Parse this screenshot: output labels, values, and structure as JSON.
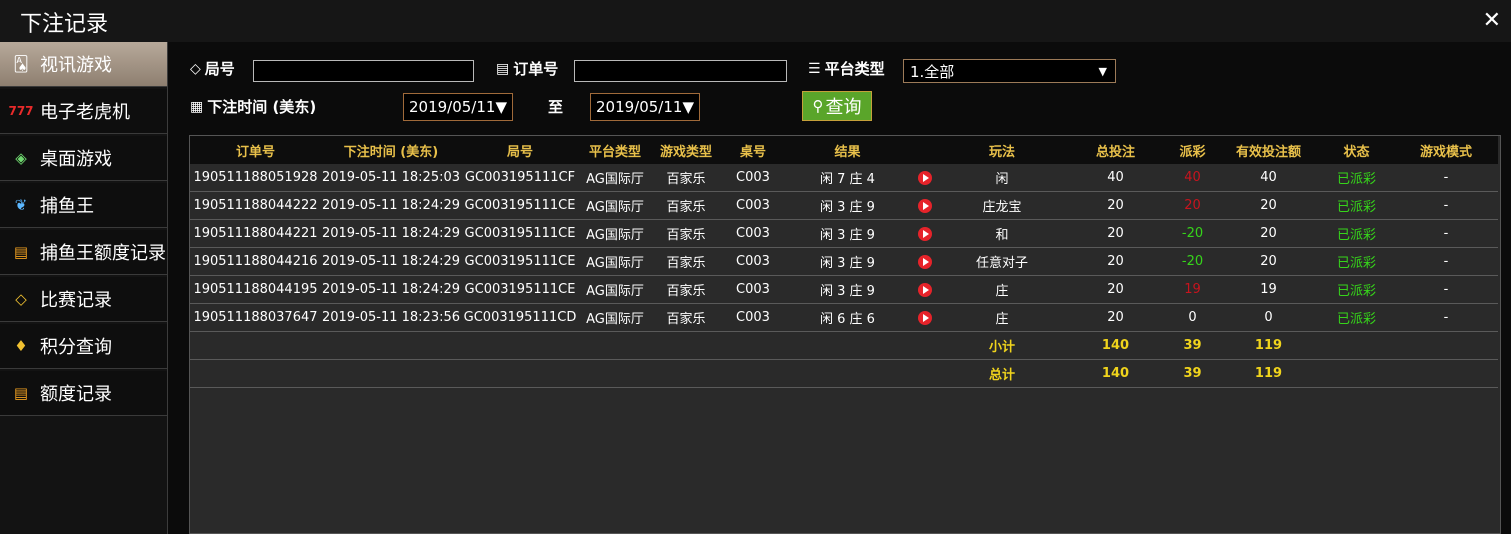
{
  "window": {
    "title": "下注记录",
    "close_icon": "close-icon"
  },
  "sidebar": {
    "items": [
      {
        "label": "视讯游戏",
        "icon": "cards-icon",
        "active": true
      },
      {
        "label": "电子老虎机",
        "icon": "slot-777-icon",
        "active": false
      },
      {
        "label": "桌面游戏",
        "icon": "chips-icon",
        "active": false
      },
      {
        "label": "捕鱼王",
        "icon": "fish-icon",
        "active": false
      },
      {
        "label": "捕鱼王额度记录",
        "icon": "doc-icon",
        "active": false
      },
      {
        "label": "比赛记录",
        "icon": "ticket-icon",
        "active": false
      },
      {
        "label": "积分查询",
        "icon": "diamond-icon",
        "active": false
      },
      {
        "label": "额度记录",
        "icon": "doc-icon",
        "active": false
      }
    ]
  },
  "filters": {
    "round_label": "局号",
    "round_value": "",
    "order_label": "订单号",
    "order_value": "",
    "platform_label": "平台类型",
    "platform_selected": "1.全部",
    "time_label": "下注时间 (美东)",
    "date_from": "2019/05/11",
    "to_label": "至",
    "date_to": "2019/05/11",
    "query_label": "查询"
  },
  "table": {
    "headers": [
      "订单号",
      "下注时间 (美东)",
      "局号",
      "平台类型",
      "游戏类型",
      "桌号",
      "结果",
      "",
      "玩法",
      "总投注",
      "派彩",
      "有效投注额",
      "状态",
      "游戏模式"
    ],
    "rows": [
      {
        "order": "190511188051928",
        "time": "2019-05-11 18:25:03",
        "round": "GC003195111CF",
        "platform": "AG国际厅",
        "game": "百家乐",
        "table": "C003",
        "result": "闲 7 庄 4",
        "play": "闲",
        "bet": "40",
        "payout": "40",
        "payout_color": "red",
        "valid": "40",
        "status": "已派彩",
        "mode": "-"
      },
      {
        "order": "190511188044222",
        "time": "2019-05-11 18:24:29",
        "round": "GC003195111CE",
        "platform": "AG国际厅",
        "game": "百家乐",
        "table": "C003",
        "result": "闲 3 庄 9",
        "play": "庄龙宝",
        "bet": "20",
        "payout": "20",
        "payout_color": "red",
        "valid": "20",
        "status": "已派彩",
        "mode": "-"
      },
      {
        "order": "190511188044221",
        "time": "2019-05-11 18:24:29",
        "round": "GC003195111CE",
        "platform": "AG国际厅",
        "game": "百家乐",
        "table": "C003",
        "result": "闲 3 庄 9",
        "play": "和",
        "bet": "20",
        "payout": "-20",
        "payout_color": "green",
        "valid": "20",
        "status": "已派彩",
        "mode": "-"
      },
      {
        "order": "190511188044216",
        "time": "2019-05-11 18:24:29",
        "round": "GC003195111CE",
        "platform": "AG国际厅",
        "game": "百家乐",
        "table": "C003",
        "result": "闲 3 庄 9",
        "play": "任意对子",
        "bet": "20",
        "payout": "-20",
        "payout_color": "green",
        "valid": "20",
        "status": "已派彩",
        "mode": "-"
      },
      {
        "order": "190511188044195",
        "time": "2019-05-11 18:24:29",
        "round": "GC003195111CE",
        "platform": "AG国际厅",
        "game": "百家乐",
        "table": "C003",
        "result": "闲 3 庄 9",
        "play": "庄",
        "bet": "20",
        "payout": "19",
        "payout_color": "red",
        "valid": "19",
        "status": "已派彩",
        "mode": "-"
      },
      {
        "order": "190511188037647",
        "time": "2019-05-11 18:23:56",
        "round": "GC003195111CD",
        "platform": "AG国际厅",
        "game": "百家乐",
        "table": "C003",
        "result": "闲 6 庄 6",
        "play": "庄",
        "bet": "20",
        "payout": "0",
        "payout_color": "white",
        "valid": "0",
        "status": "已派彩",
        "mode": "-"
      }
    ],
    "subtotal": {
      "label": "小计",
      "bet": "140",
      "payout": "39",
      "valid": "119"
    },
    "total": {
      "label": "总计",
      "bet": "140",
      "payout": "39",
      "valid": "119"
    }
  },
  "colors": {
    "header_text": "#e8c04a",
    "status_green": "#36d51a",
    "payout_red": "#c8141e",
    "button_green": "#5aa52a",
    "active_tab": "#a89a8c"
  }
}
